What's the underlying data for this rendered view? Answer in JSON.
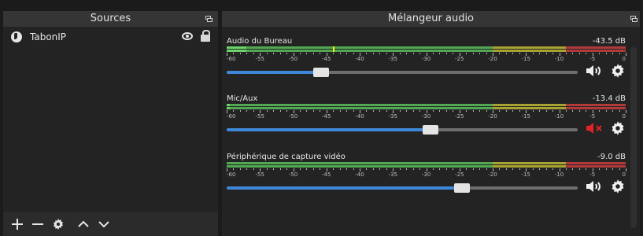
{
  "sources": {
    "title": "Sources",
    "items": [
      {
        "name": "TabonIP",
        "visible": true,
        "locked": true
      }
    ],
    "toolbar": [
      "add-icon",
      "remove-icon",
      "gear-icon",
      "move-up-icon",
      "move-down-icon"
    ]
  },
  "mixer": {
    "title": "Mélangeur audio",
    "scale_labels": [
      "-60",
      "-55",
      "-50",
      "-45",
      "-40",
      "-35",
      "-30",
      "-25",
      "-20",
      "-15",
      "-10",
      "-5",
      "0"
    ],
    "colors": {
      "green": "#52a852",
      "yellow": "#a8a232",
      "red": "#b03a3a",
      "level": "#6ad66a",
      "slider_fill": "#3e88d8",
      "muted": "#e02424"
    },
    "channels": [
      {
        "name": "Audio du Bureau",
        "db": "-43.5 dB",
        "level_db": -57,
        "peak_db": -44,
        "volume": 0.27,
        "muted": false
      },
      {
        "name": "Mic/Aux",
        "db": "-13.4 dB",
        "level_db": -60,
        "peak_db": null,
        "volume": 0.58,
        "muted": true
      },
      {
        "name": "Périphérique de capture vidéo",
        "db": "-9.0 dB",
        "level_db": null,
        "peak_db": null,
        "volume": 0.67,
        "muted": false
      }
    ]
  }
}
